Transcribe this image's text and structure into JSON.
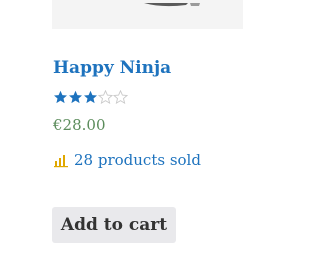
{
  "product": {
    "title": "Happy Ninja",
    "rating": 3,
    "rating_max": 5,
    "price": "€28.00",
    "sold_text": "28 products sold",
    "add_to_cart_label": "Add to cart"
  },
  "icons": {
    "star_filled": "star-filled-icon",
    "star_empty": "star-empty-icon",
    "sold": "bar-chart-icon"
  },
  "colors": {
    "title": "#1e73be",
    "stars": "#1e73be",
    "price": "#5b8c5b",
    "sold_icon": "#e0a800",
    "sold_text": "#1e73be",
    "button_bg": "#e9e9ec",
    "button_text": "#333333"
  }
}
